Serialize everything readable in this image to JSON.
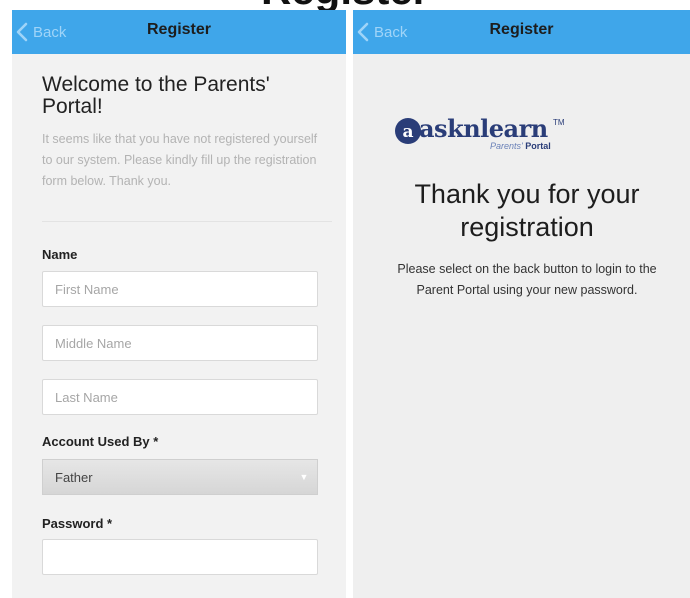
{
  "page_heading": "Register",
  "left_screen": {
    "nav": {
      "back_label": "Back",
      "title": "Register"
    },
    "welcome_title": "Welcome to the Parents' Portal!",
    "intro_text": "It seems like that you have not registered yourself to our system. Please kindly fill up the registration form below. Thank you.",
    "name_section": {
      "label": "Name",
      "first_name_placeholder": "First Name",
      "middle_name_placeholder": "Middle Name",
      "last_name_placeholder": "Last Name"
    },
    "account_used_by": {
      "label": "Account Used By *",
      "selected": "Father"
    },
    "password": {
      "label": "Password *",
      "value": ""
    }
  },
  "right_screen": {
    "nav": {
      "back_label": "Back",
      "title": "Register"
    },
    "logo": {
      "wordmark": "asknlearn",
      "tm": "TM",
      "sub_prefix": "Parents'",
      "sub_suffix": "Portal"
    },
    "thank_you_title": "Thank you for your registration",
    "message": "Please select on the back button to login to the Parent Portal using your new password."
  },
  "colors": {
    "navbar": "#3fa6ea",
    "back_text": "#9fd4f8",
    "brand_navy": "#2a3d78",
    "intro_grey": "#b3b3b3"
  },
  "icons": [
    "chevron-left-icon",
    "dropdown-arrow-icon",
    "asknlearn-logo-icon"
  ]
}
